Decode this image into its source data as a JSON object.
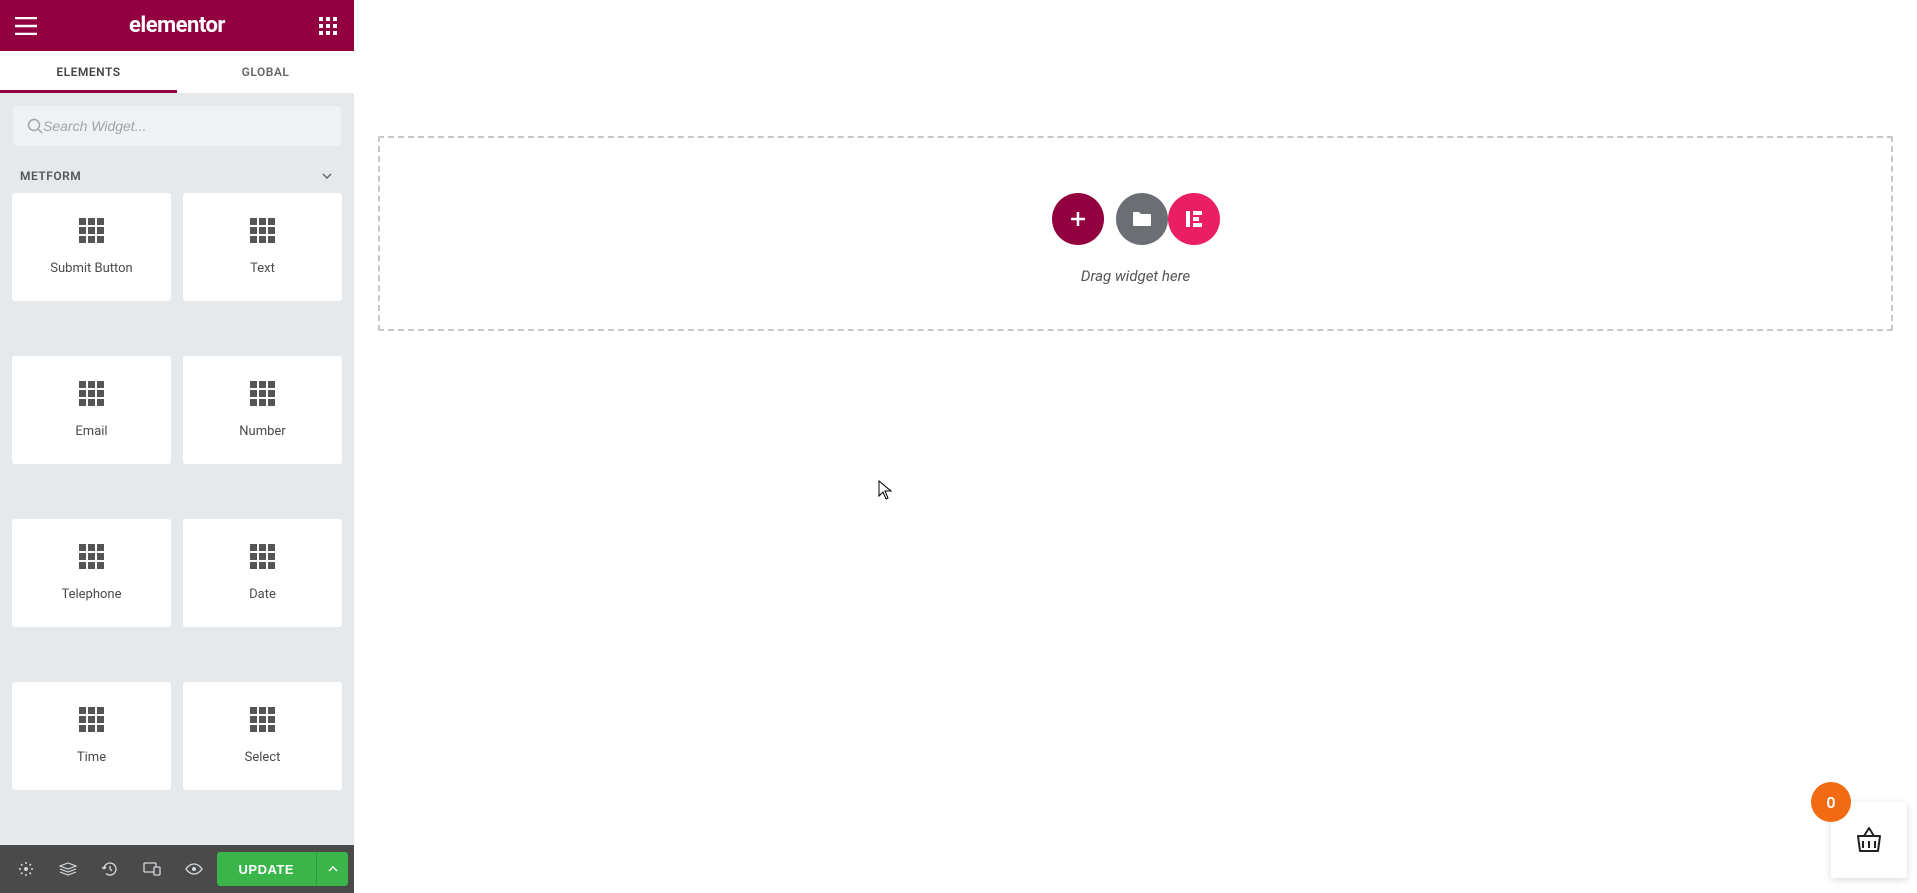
{
  "header": {
    "logo": "elementor"
  },
  "tabs": {
    "elements": "ELEMENTS",
    "global": "GLOBAL"
  },
  "search": {
    "placeholder": "Search Widget..."
  },
  "category": {
    "name": "METFORM"
  },
  "widgets": [
    {
      "label": "Submit Button"
    },
    {
      "label": "Text"
    },
    {
      "label": "Email"
    },
    {
      "label": "Number"
    },
    {
      "label": "Telephone"
    },
    {
      "label": "Date"
    },
    {
      "label": "Time"
    },
    {
      "label": "Select"
    }
  ],
  "footer": {
    "update_label": "UPDATE"
  },
  "canvas": {
    "drop_text": "Drag widget here"
  },
  "cart": {
    "count": "0"
  },
  "colors": {
    "brand": "#93003f",
    "accent_pink": "#e91e63",
    "publish": "#39b54a",
    "badge": "#f26a11"
  }
}
